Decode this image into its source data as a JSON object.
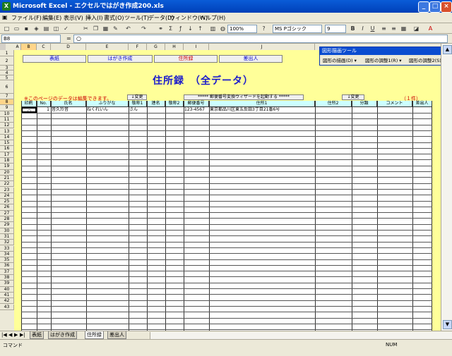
{
  "window": {
    "title": "Microsoft Excel - エクセルではがき作成200.xls"
  },
  "menu": [
    "ファイル(F)",
    "編集(E)",
    "表示(V)",
    "挿入(I)",
    "書式(O)",
    "ツール(T)",
    "データ(D)",
    "ウィンドウ(W)",
    "ヘルプ(H)"
  ],
  "toolbar": {
    "zoom": "100%",
    "font_name": "MS Pゴシック",
    "font_size": "9"
  },
  "formula_bar": {
    "name_box": "B8",
    "fx": "=",
    "value": "○"
  },
  "columns": [
    "A",
    "B",
    "C",
    "D",
    "E",
    "F",
    "G",
    "H",
    "I",
    "J"
  ],
  "rows": [
    "1",
    "2",
    "3",
    "4",
    "5",
    "6",
    "7",
    "8",
    "9",
    "10",
    "11",
    "12",
    "13",
    "14",
    "15",
    "16",
    "17",
    "18",
    "19",
    "20",
    "21",
    "22",
    "23",
    "24",
    "25",
    "26",
    "27",
    "28",
    "29",
    "30",
    "31",
    "32",
    "33",
    "34",
    "35",
    "36",
    "37",
    "38",
    "39",
    "40",
    "41",
    "42",
    "43"
  ],
  "sheet": {
    "nav_buttons": [
      "表紙",
      "はがき作成",
      "住所録",
      "差出人"
    ],
    "title": "住所録　（全データ）",
    "edit_note": "※このページのデータは編集できます。",
    "change_button": "↓変更",
    "wizard_button": "***** 郵便番号変換ウィザードを起動する *****",
    "change_button2": "↓変更",
    "count": "（１件）",
    "table_headers": [
      "印刷",
      "No.",
      "氏名",
      "ふりがな",
      "敬称1",
      "連名",
      "敬称2",
      "郵便番号",
      "住所1",
      "住所2",
      "分類",
      "コメント",
      "差出人"
    ],
    "rows": [
      [
        "○",
        "1",
        "音久玲音",
        "ねくれいん",
        "さん",
        "",
        "",
        "123-4567",
        "東京都品川区東五反田3丁目21番6号",
        "",
        "",
        "",
        ""
      ]
    ]
  },
  "shape_panel": {
    "title": "図形描画ツール",
    "items": [
      "図形の描画(D) ▾",
      "図形の調整1(R) ▾",
      "図形の調整2(S) ▾"
    ]
  },
  "tabs": [
    "表紙",
    "はがき作成",
    "住所録",
    "差出人"
  ],
  "status": {
    "mode": "コマンド",
    "num": "NUM"
  }
}
